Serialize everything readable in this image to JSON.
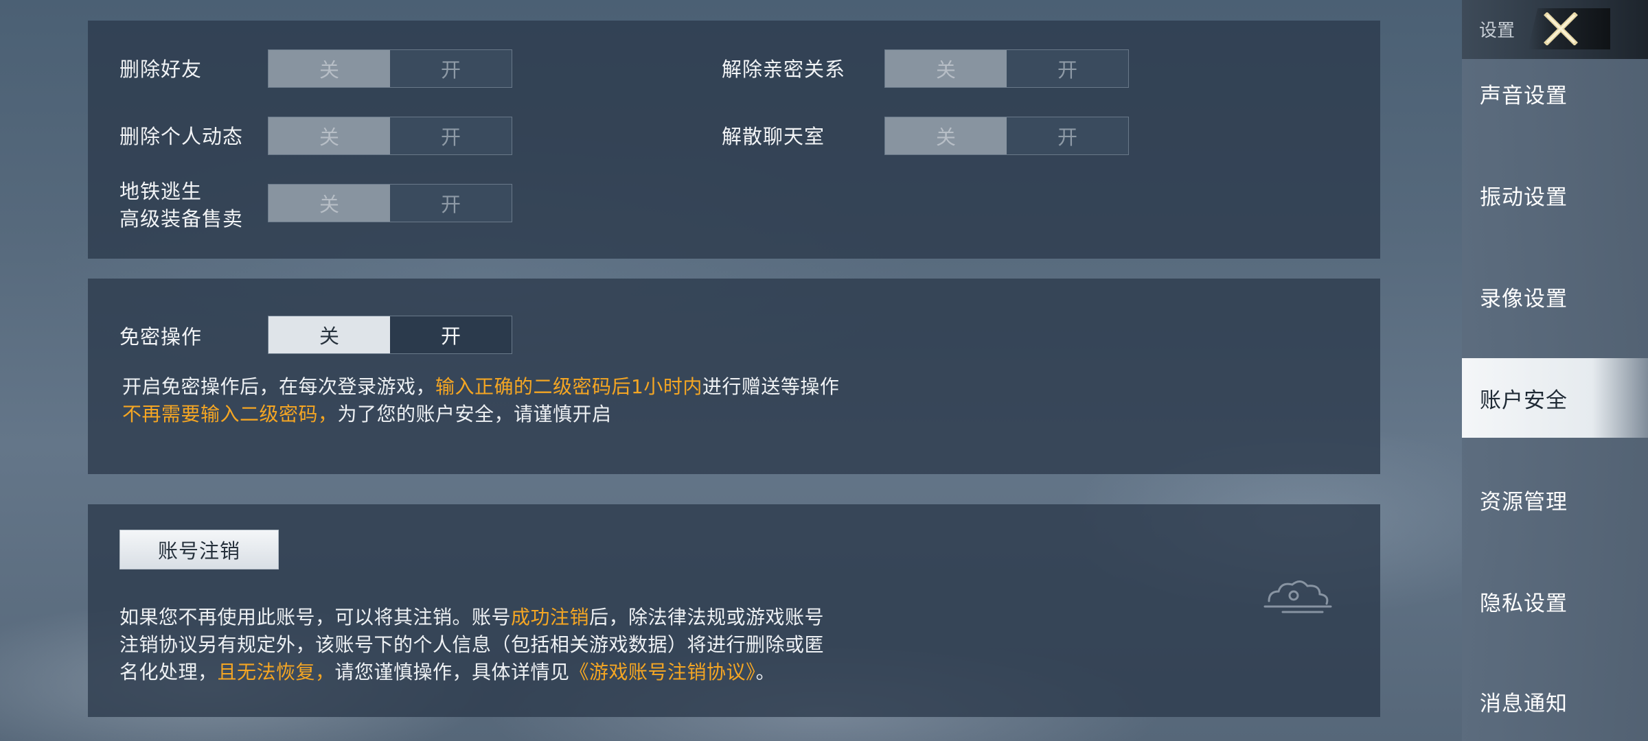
{
  "toggle_labels": {
    "off": "关",
    "on": "开"
  },
  "panel1": {
    "rows": [
      {
        "label": "删除好友",
        "state": "off"
      },
      {
        "label": "解除亲密关系",
        "state": "off"
      },
      {
        "label": "删除个人动态",
        "state": "off"
      },
      {
        "label": "解散聊天室",
        "state": "off"
      },
      {
        "label_line1": "地铁逃生",
        "label_line2": "高级装备售卖",
        "state": "off"
      }
    ]
  },
  "panel2": {
    "label": "免密操作",
    "state": "off",
    "desc_line1_a": "开启免密操作后，在每次登录游戏，",
    "desc_line1_b": "输入正确的二级密码后1小时内",
    "desc_line1_c": "进行赠送等操作",
    "desc_line2_a": "不再需要输入二级密码，",
    "desc_line2_b": "为了您的账户安全，请谨慎开启"
  },
  "panel3": {
    "button": "账号注销",
    "desc_line1_a": "如果您不再使用此账号，可以将其注销。账号",
    "desc_line1_b": "成功注销",
    "desc_line1_c": "后，除法律法规或游戏账号",
    "desc_line2": "注销协议另有规定外，该账号下的个人信息（包括相关游戏数据）将进行删除或匿",
    "desc_line3_a": "名化处理，",
    "desc_line3_b": "且无法恢复，",
    "desc_line3_c": "请您谨慎操作，具体详情见",
    "desc_line3_d": "《游戏账号注销协议》",
    "desc_line3_e": "。"
  },
  "sidebar": {
    "title": "设置",
    "active": "账户安全",
    "items": [
      {
        "label": "声音设置"
      },
      {
        "label": "振动设置"
      },
      {
        "label": "录像设置"
      },
      {
        "label": "账户安全"
      },
      {
        "label": "资源管理"
      },
      {
        "label": "隐私设置"
      },
      {
        "label": "消息通知"
      }
    ]
  },
  "colors": {
    "highlight": "#f5a623",
    "panel_bg": "#2c3a4b",
    "active_item_bg": "#f4f6f8"
  },
  "icons": {
    "close": "close-icon",
    "decoration": "cloud-icon"
  }
}
